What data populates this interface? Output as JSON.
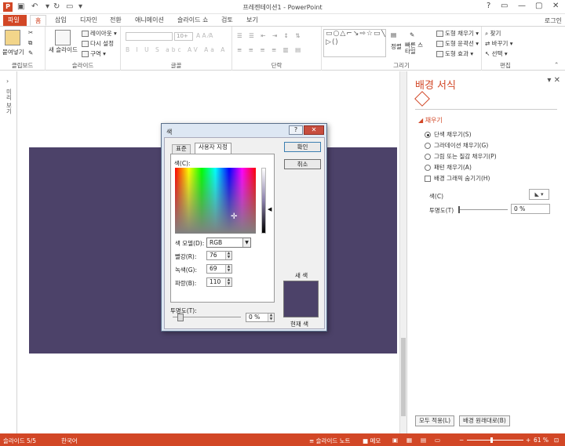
{
  "app": {
    "title": "프레젠테이션1 - PowerPoint",
    "logo": "P",
    "login": "로그인"
  },
  "window_controls": [
    "?",
    "▭",
    "—",
    "▢",
    "✕"
  ],
  "tabs": [
    {
      "label": "파일"
    },
    {
      "label": "홈"
    },
    {
      "label": "삽입"
    },
    {
      "label": "디자인"
    },
    {
      "label": "전환"
    },
    {
      "label": "애니메이션"
    },
    {
      "label": "슬라이드 쇼"
    },
    {
      "label": "검토"
    },
    {
      "label": "보기"
    }
  ],
  "ribbon": {
    "clipboard": {
      "label": "클립보드",
      "paste": "붙여넣기"
    },
    "slides": {
      "label": "슬라이드",
      "new_slide": "새 슬라이드",
      "layout": "레이아웃 ▾",
      "reset": "다시 설정",
      "section": "구역 ▾"
    },
    "font": {
      "label": "글꼴",
      "size": "10+"
    },
    "paragraph": {
      "label": "단락"
    },
    "drawing": {
      "label": "그리기",
      "arrange": "정렬",
      "quick_styles": "빠른 스타일",
      "shape_fill": "도형 채우기 ▾",
      "shape_outline": "도형 윤곽선 ▾",
      "shape_effects": "도형 효과 ▾"
    },
    "editing": {
      "label": "편집",
      "find": "찾기",
      "replace": "바꾸기 ▾",
      "select": "선택 ▾"
    }
  },
  "left_pane": {
    "label": "미리 보기"
  },
  "format_pane": {
    "title": "배경 서식",
    "fill_section": "채우기",
    "options": [
      {
        "label": "단색 채우기(S)",
        "selected": true
      },
      {
        "label": "그라데이션 채우기(G)",
        "selected": false
      },
      {
        "label": "그림 또는 질감 채우기(P)",
        "selected": false
      },
      {
        "label": "패턴 채우기(A)",
        "selected": false
      }
    ],
    "hide_graphics": "배경 그래픽 숨기기(H)",
    "color_label": "색(C)",
    "transparency_label": "투명도(T)",
    "transparency_value": "0 %",
    "apply_all": "모두 적용(L)",
    "reset_bg": "배경 원래대로(B)"
  },
  "dialog": {
    "title": "색",
    "help": "?",
    "close": "✕",
    "tabs": [
      {
        "label": "표준"
      },
      {
        "label": "사용자 지정"
      }
    ],
    "color_label": "색(C):",
    "model_label": "색 모델(D):",
    "model_value": "RGB",
    "red_label": "빨강(R):",
    "red_value": "76",
    "green_label": "녹색(G):",
    "green_value": "69",
    "blue_label": "파랑(B):",
    "blue_value": "110",
    "ok": "확인",
    "cancel": "취소",
    "new_color": "새 색",
    "current_color": "현재 색",
    "transparency_label": "투명도(T):",
    "transparency_value": "0 %"
  },
  "status": {
    "slide": "슬라이드 5/5",
    "language": "한국어",
    "notes": "≡ 슬라이드 노트",
    "comments": "■ 메모",
    "zoom": "61 %"
  },
  "colors": {
    "accent": "#d24726",
    "slide_bg": "#4c4269"
  }
}
